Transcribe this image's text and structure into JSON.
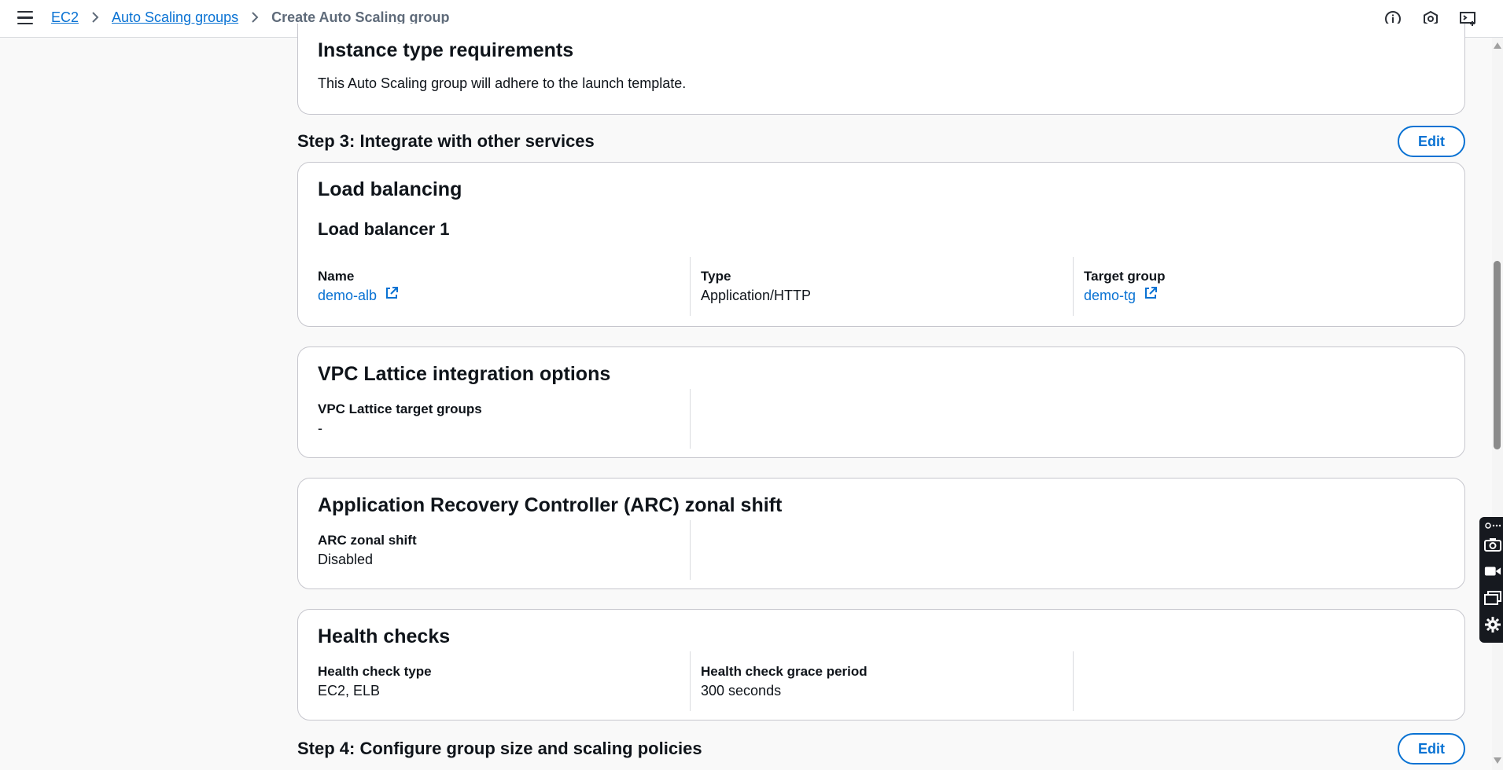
{
  "breadcrumb": {
    "items": [
      "EC2",
      "Auto Scaling groups"
    ],
    "current": "Create Auto Scaling group"
  },
  "header_icons": [
    "info-icon",
    "settings-hex-icon",
    "cloudshell-icon"
  ],
  "instance_type": {
    "title": "Instance type requirements",
    "description": "This Auto Scaling group will adhere to the launch template."
  },
  "step3": {
    "heading": "Step 3: Integrate with other services",
    "edit_label": "Edit"
  },
  "load_balancing": {
    "title": "Load balancing",
    "subtitle": "Load balancer 1",
    "name_label": "Name",
    "name_value": "demo-alb",
    "type_label": "Type",
    "type_value": "Application/HTTP",
    "target_group_label": "Target group",
    "target_group_value": "demo-tg"
  },
  "vpc_lattice": {
    "title": "VPC Lattice integration options",
    "label": "VPC Lattice target groups",
    "value": "-"
  },
  "arc": {
    "title": "Application Recovery Controller (ARC) zonal shift",
    "label": "ARC zonal shift",
    "value": "Disabled"
  },
  "health_checks": {
    "title": "Health checks",
    "type_label": "Health check type",
    "type_value": "EC2, ELB",
    "grace_label": "Health check grace period",
    "grace_value": "300 seconds"
  },
  "step4": {
    "heading": "Step 4: Configure group size and scaling policies",
    "edit_label": "Edit"
  },
  "colors": {
    "link": "#0972d3",
    "text": "#0f141a",
    "border": "#c6c6cd",
    "background": "#f9f9f9"
  }
}
